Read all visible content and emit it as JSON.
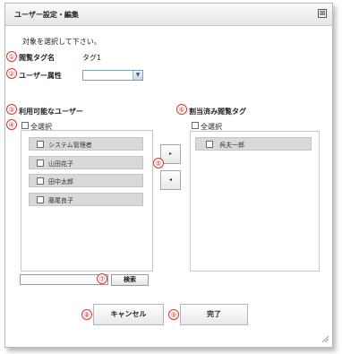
{
  "dialog": {
    "title": "ユーザー設定・編集",
    "close_glyph": "⊠",
    "instruction": "対象を選択して下さい。"
  },
  "fields": {
    "tag_name_label": "閲覧タグ名",
    "tag_name_value": "タグ1",
    "user_attr_label": "ユーザー属性",
    "user_attr_value": ""
  },
  "available": {
    "heading": "利用可能なユーザー",
    "select_all": "全選択",
    "items": [
      "システム管理者",
      "山田花子",
      "田中太郎",
      "藤尾良子"
    ]
  },
  "assigned": {
    "heading": "割当済み閲覧タグ",
    "select_all": "全選択",
    "items": [
      "呉夫一郎"
    ]
  },
  "move": {
    "add": "▸",
    "remove": "◂"
  },
  "search": {
    "button": "検索",
    "value": ""
  },
  "buttons": {
    "cancel": "キャンセル",
    "done": "完了"
  },
  "markers": [
    "①",
    "②",
    "③",
    "④",
    "⑤",
    "⑥",
    "⑦",
    "⑧",
    "⑨"
  ],
  "colors": {
    "marker": "#d6362c",
    "item_bg": "#d9d9d9",
    "select_border": "#7f9db9"
  }
}
